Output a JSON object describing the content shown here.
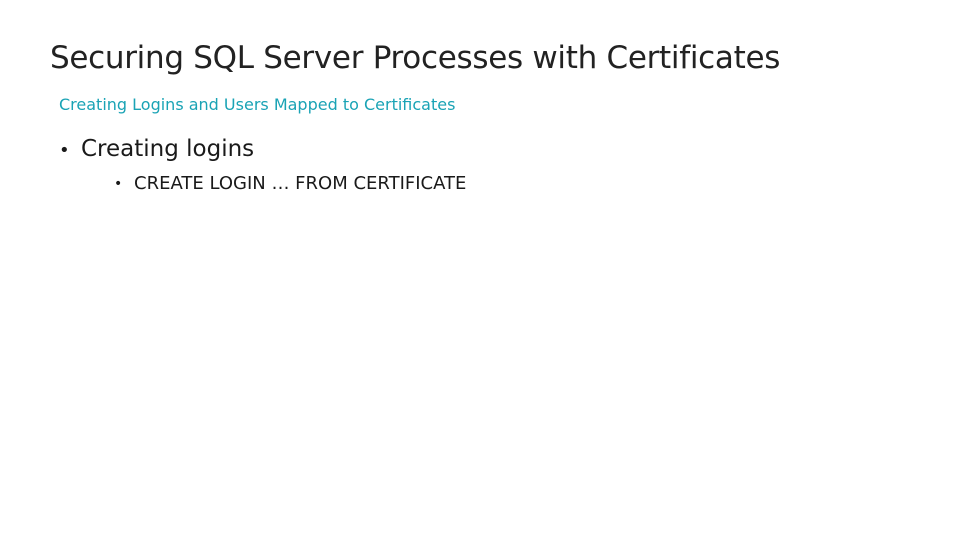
{
  "slide": {
    "title": "Securing SQL Server Processes with Certificates",
    "subtitle": "Creating Logins and Users Mapped to Certificates",
    "bullets": [
      {
        "level": 1,
        "text": "Creating logins"
      },
      {
        "level": 2,
        "text": "CREATE LOGIN … FROM CERTIFICATE"
      }
    ],
    "bullet_glyph": "•",
    "colors": {
      "title": "#222222",
      "subtitle": "#1aa3b5",
      "body": "#1a1a1a",
      "background": "#ffffff"
    }
  }
}
